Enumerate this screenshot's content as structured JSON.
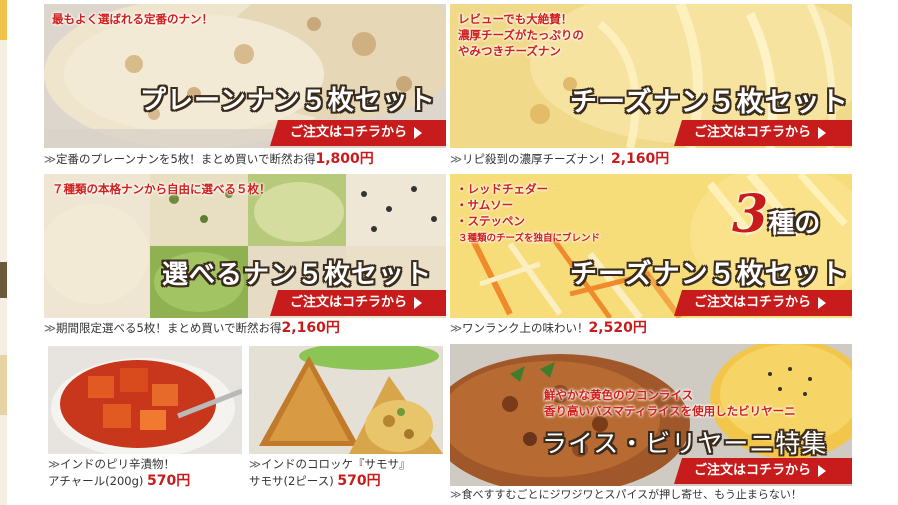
{
  "banners": {
    "plain": {
      "tagline": "最もよく選ばれる定番のナン！",
      "title": "プレーンナン５枚セット",
      "button": "ご注文はコチラから",
      "caption": "定番のプレーンナンを5枚！まとめ買いで断然お得",
      "price": "1,800円"
    },
    "cheese": {
      "tagline1": "レビューでも大絶賛！",
      "tagline2": "濃厚チーズがたっぷりの",
      "tagline3": "やみつきチーズナン",
      "title": "チーズナン５枚セット",
      "button": "ご注文はコチラから",
      "caption": "リピ殺到の濃厚チーズナン！",
      "price": "2,160円"
    },
    "choose": {
      "tagline": "７種類の本格ナンから自由に選べる５枚！",
      "title": "選べるナン５枚セット",
      "button": "ご注文はコチラから",
      "caption": "期間限定選べる5枚！まとめ買いで断然お得",
      "price": "2,160円"
    },
    "cheese3": {
      "item1": "・レッドチェダー",
      "item2": "・サムソー",
      "item3": "・ステッペン",
      "note": "３種類のチーズを独自にブレンド",
      "badge_num": "3",
      "badge_word": "種の",
      "title": "チーズナン５枚セット",
      "button": "ご注文はコチラから",
      "caption": "ワンランク上の味わい！",
      "price": "2,520円"
    },
    "achar": {
      "caption1": "インドのピリ辛漬物！",
      "caption2": "アチャール(200g)",
      "price": "570円"
    },
    "samosa": {
      "caption1": "インドのコロッケ『サモサ』",
      "caption2": "サモサ(2ピース)",
      "price": "570円"
    },
    "rice": {
      "tagline1": "鮮やかな黄色のウコンライス",
      "tagline2": "香り高いバスマティライスを使用したビリヤーニ",
      "title": "ライス・ビリヤーニ特集",
      "button": "ご注文はコチラから",
      "caption": "食べすすむごとにジワジワとスパイスが押し寄せ、もう止まらない！"
    }
  },
  "marker": "≫",
  "colors": {
    "accent": "#c81c1c",
    "title_outline": "#3a2b1c"
  }
}
